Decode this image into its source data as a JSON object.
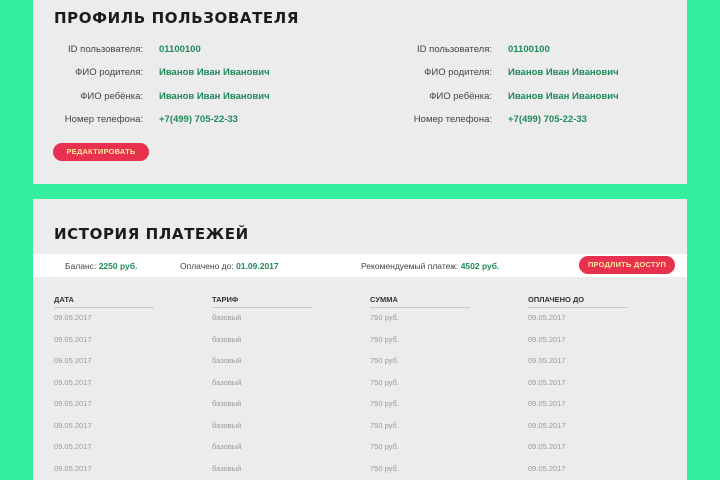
{
  "profile": {
    "title": "ПРОФИЛЬ ПОЛЬЗОВАТЕЛЯ",
    "columns": [
      {
        "rows": [
          {
            "label": "ID пользователя:",
            "value": "01100100"
          },
          {
            "label": "ФИО родителя:",
            "value": "Иванов Иван Иванович"
          },
          {
            "label": "ФИО ребёнка:",
            "value": "Иванов Иван Иванович"
          },
          {
            "label": "Номер телефона:",
            "value": "+7(499) 705-22-33"
          }
        ]
      },
      {
        "rows": [
          {
            "label": "ID пользователя:",
            "value": "01100100"
          },
          {
            "label": "ФИО родителя:",
            "value": "Иванов Иван Иванович"
          },
          {
            "label": "ФИО ребёнка:",
            "value": "Иванов Иван Иванович"
          },
          {
            "label": "Номер телефона:",
            "value": "+7(499) 705-22-33"
          }
        ]
      }
    ],
    "edit_label": "РЕДАКТИРОВАТЬ"
  },
  "payments": {
    "title": "ИСТОРИЯ ПЛАТЕЖЕЙ",
    "summary": {
      "balance_label": "Баланс:",
      "balance_value": "2250 руб.",
      "paid_until_label": "Оплачено до:",
      "paid_until_value": "01.09.2017",
      "recommended_label": "Рекомендуемый платеж:",
      "recommended_value": "4502 руб."
    },
    "extend_label": "ПРОДЛИТЬ ДОСТУП",
    "headers": [
      "ДАТА",
      "ТАРИФ",
      "СУММА",
      "ОПЛАЧЕНО ДО"
    ],
    "rows": [
      [
        "09.05.2017",
        "базовый",
        "750 руб.",
        "09.05.2017"
      ],
      [
        "09.05.2017",
        "базовый",
        "750 руб.",
        "09.05.2017"
      ],
      [
        "09.05.2017",
        "базовый",
        "750 руб.",
        "09.05.2017"
      ],
      [
        "09.05.2017",
        "базовый",
        "750 руб.",
        "09.05.2017"
      ],
      [
        "09.05.2017",
        "базовый",
        "750 руб.",
        "09.05.2017"
      ],
      [
        "09.05.2017",
        "базовый",
        "750 руб.",
        "09.05.2017"
      ],
      [
        "09.05.2017",
        "базовый",
        "750 руб.",
        "09.05.2017"
      ],
      [
        "09.05.2017",
        "базовый",
        "750 руб.",
        "09.05.2017"
      ]
    ]
  },
  "colors": {
    "background": "#35ee9e",
    "card": "#ececec",
    "accent_value": "#1f8a5a",
    "button": "#e8314f",
    "button_text": "#ffe8a0"
  }
}
